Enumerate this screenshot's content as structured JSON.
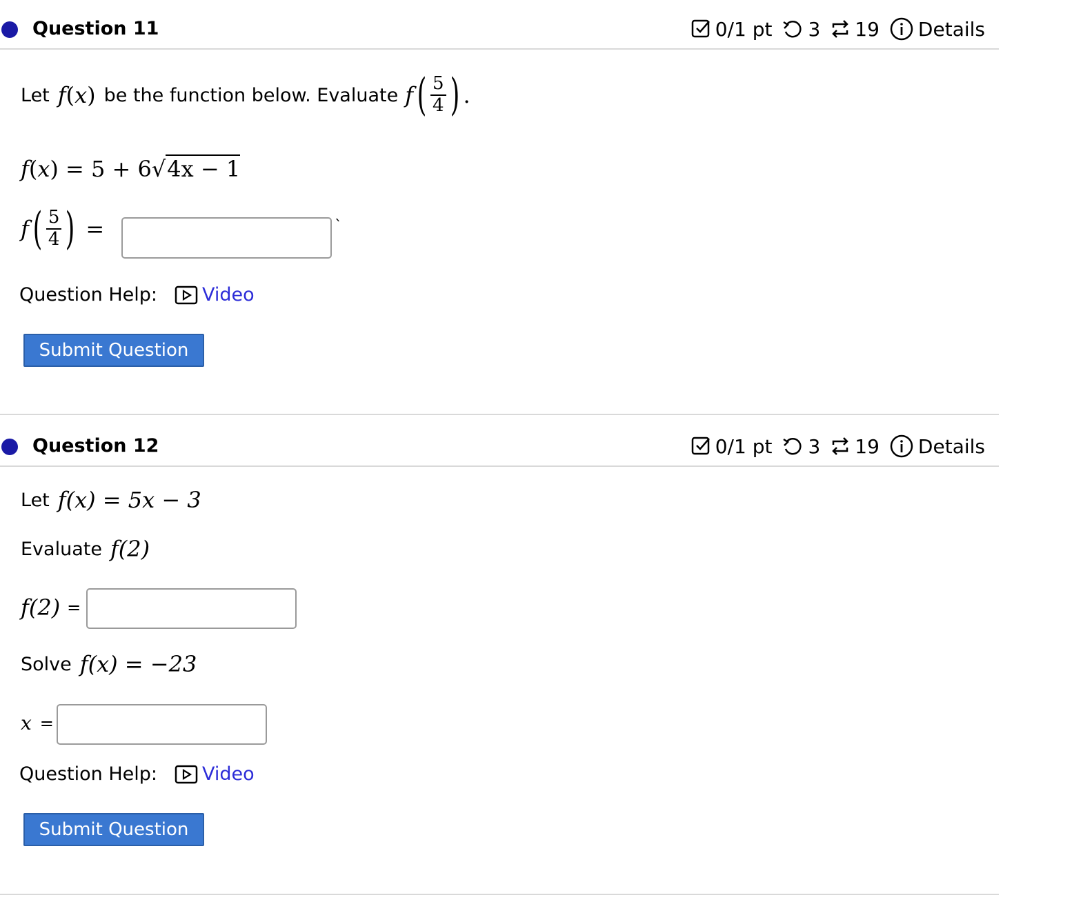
{
  "q11": {
    "title": "Question 11",
    "points": "0/1 pt",
    "retries": "3",
    "attempts": "19",
    "details": "Details",
    "prompt_prefix": "Let",
    "prompt_mid": "be the function below. Evaluate",
    "func_name": "f",
    "var": "x",
    "frac_num": "5",
    "frac_den": "4",
    "func_def_rhs_a": "= 5 + 6",
    "func_def_sqrt": "4x − 1",
    "equals": "=",
    "tick": "`",
    "help_label": "Question Help:",
    "video_label": "Video",
    "submit_label": "Submit Question"
  },
  "q12": {
    "title": "Question 12",
    "points": "0/1 pt",
    "retries": "3",
    "attempts": "19",
    "details": "Details",
    "line1_prefix": "Let",
    "line1_math": "f(x) = 5x − 3",
    "line2_prefix": "Evaluate",
    "line2_math": "f(2)",
    "ans1_label": "f(2)",
    "ans1_eq": "=",
    "line3_prefix": "Solve",
    "line3_math": "f(x) = −23",
    "ans2_label": "x",
    "ans2_eq": "=",
    "help_label": "Question Help:",
    "video_label": "Video",
    "submit_label": "Submit Question"
  },
  "colors": {
    "dot": "#1a1aa6",
    "submit_bg": "#3a78d1",
    "link": "#2d2dd8",
    "divider": "#d9d9d9"
  },
  "icons": [
    "checkbox-icon",
    "retry-icon",
    "attempts-icon",
    "info-icon",
    "video-icon"
  ]
}
